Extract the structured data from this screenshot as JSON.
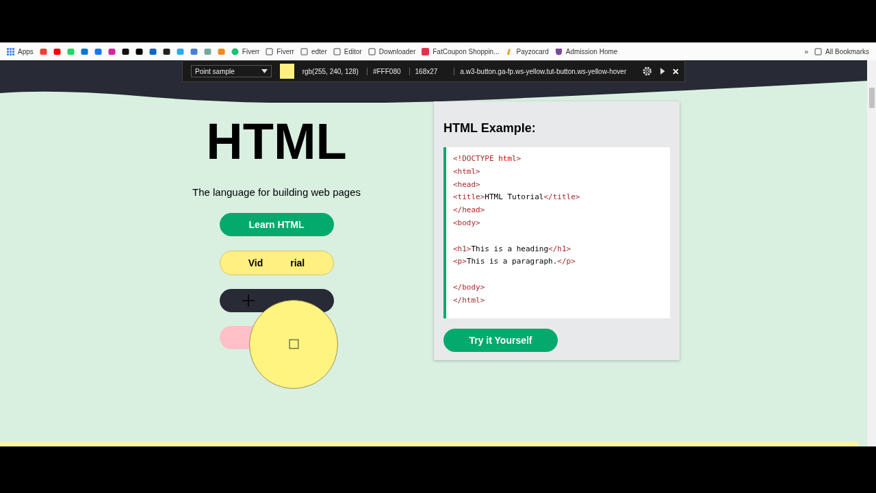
{
  "bookmarks": {
    "apps_label": "Apps",
    "icons": [
      {
        "kind": "mail"
      },
      {
        "kind": "video"
      },
      {
        "kind": "chat"
      },
      {
        "kind": "tiles"
      },
      {
        "kind": "social"
      },
      {
        "kind": "camera"
      },
      {
        "kind": "note"
      },
      {
        "kind": "cross"
      },
      {
        "kind": "in"
      },
      {
        "kind": "cat"
      },
      {
        "kind": "plane"
      },
      {
        "kind": "translate"
      },
      {
        "kind": "knot"
      },
      {
        "kind": "fox"
      }
    ],
    "items": [
      {
        "kind": "green",
        "label": "Fiverr"
      },
      {
        "kind": "folder",
        "label": "Fiverr"
      },
      {
        "kind": "folder",
        "label": "edter"
      },
      {
        "kind": "folder",
        "label": "Editor"
      },
      {
        "kind": "folder",
        "label": "Downloader"
      },
      {
        "kind": "badge",
        "label": "FatCoupon Shoppin..."
      },
      {
        "kind": "pen",
        "label": "Payzocard"
      },
      {
        "kind": "crest",
        "label": "Admission Home"
      }
    ],
    "overflow": "»",
    "all_label": "All Bookmarks"
  },
  "picker": {
    "mode": "Point sample",
    "rgb": "rgb(255, 240, 128)",
    "hex": "#FFF080",
    "size": "168x27",
    "selector": "a.w3-button.ga-fp.ws-yellow.tut-button.ws-yellow-hover"
  },
  "hero": {
    "title": "HTML",
    "subtitle": "The language for building web pages",
    "learn_button": "Learn HTML",
    "video_button_parts": [
      "Vid",
      "rial"
    ]
  },
  "example": {
    "title": "HTML Example:",
    "lines": [
      {
        "kind": "code",
        "segments": [
          {
            "kind": "tag",
            "text": "<!DOCTYPE "
          },
          {
            "kind": "keyword",
            "text": "html"
          },
          {
            "kind": "tag",
            "text": ">"
          }
        ]
      },
      {
        "kind": "code",
        "segments": [
          {
            "kind": "tag",
            "text": "<html>"
          }
        ]
      },
      {
        "kind": "code",
        "segments": [
          {
            "kind": "tag",
            "text": "<head>"
          }
        ]
      },
      {
        "kind": "code",
        "segments": [
          {
            "kind": "tag",
            "text": "<title>"
          },
          {
            "kind": "text",
            "text": "HTML Tutorial"
          },
          {
            "kind": "tag",
            "text": "</title>"
          }
        ]
      },
      {
        "kind": "code",
        "segments": [
          {
            "kind": "tag",
            "text": "</head>"
          }
        ]
      },
      {
        "kind": "code",
        "segments": [
          {
            "kind": "tag",
            "text": "<body>"
          }
        ]
      },
      {
        "kind": "blank"
      },
      {
        "kind": "code",
        "segments": [
          {
            "kind": "tag",
            "text": "<h1>"
          },
          {
            "kind": "text",
            "text": "This is a heading"
          },
          {
            "kind": "tag",
            "text": "</h1>"
          }
        ]
      },
      {
        "kind": "code",
        "segments": [
          {
            "kind": "tag",
            "text": "<p>"
          },
          {
            "kind": "text",
            "text": "This is a paragraph."
          },
          {
            "kind": "tag",
            "text": "</p>"
          }
        ]
      },
      {
        "kind": "blank"
      },
      {
        "kind": "code",
        "segments": [
          {
            "kind": "tag",
            "text": "</body>"
          }
        ]
      },
      {
        "kind": "code",
        "segments": [
          {
            "kind": "tag",
            "text": "</html>"
          }
        ]
      }
    ],
    "button": "Try it Yourself"
  }
}
